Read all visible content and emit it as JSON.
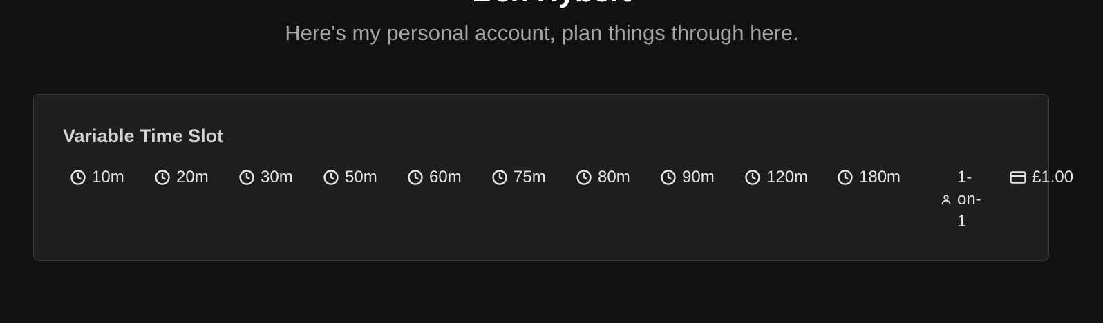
{
  "profile": {
    "name": "Ben Hybert",
    "description": "Here's my personal account, plan things through here."
  },
  "event_type": {
    "title": "Variable Time Slot",
    "durations": [
      "10m",
      "20m",
      "30m",
      "50m",
      "60m",
      "75m",
      "80m",
      "90m",
      "120m",
      "180m"
    ],
    "duration_icon": "clock-icon",
    "seats_label": "1-on-1",
    "seats_icon": "user-icon",
    "price": "£1.00",
    "price_icon": "credit-card-icon"
  },
  "colors": {
    "background": "#111111",
    "card": "#1e1e1e",
    "card_border": "#3a3a3a",
    "title_text": "#d4d4d4",
    "subtitle_text": "#a6a6a6"
  }
}
